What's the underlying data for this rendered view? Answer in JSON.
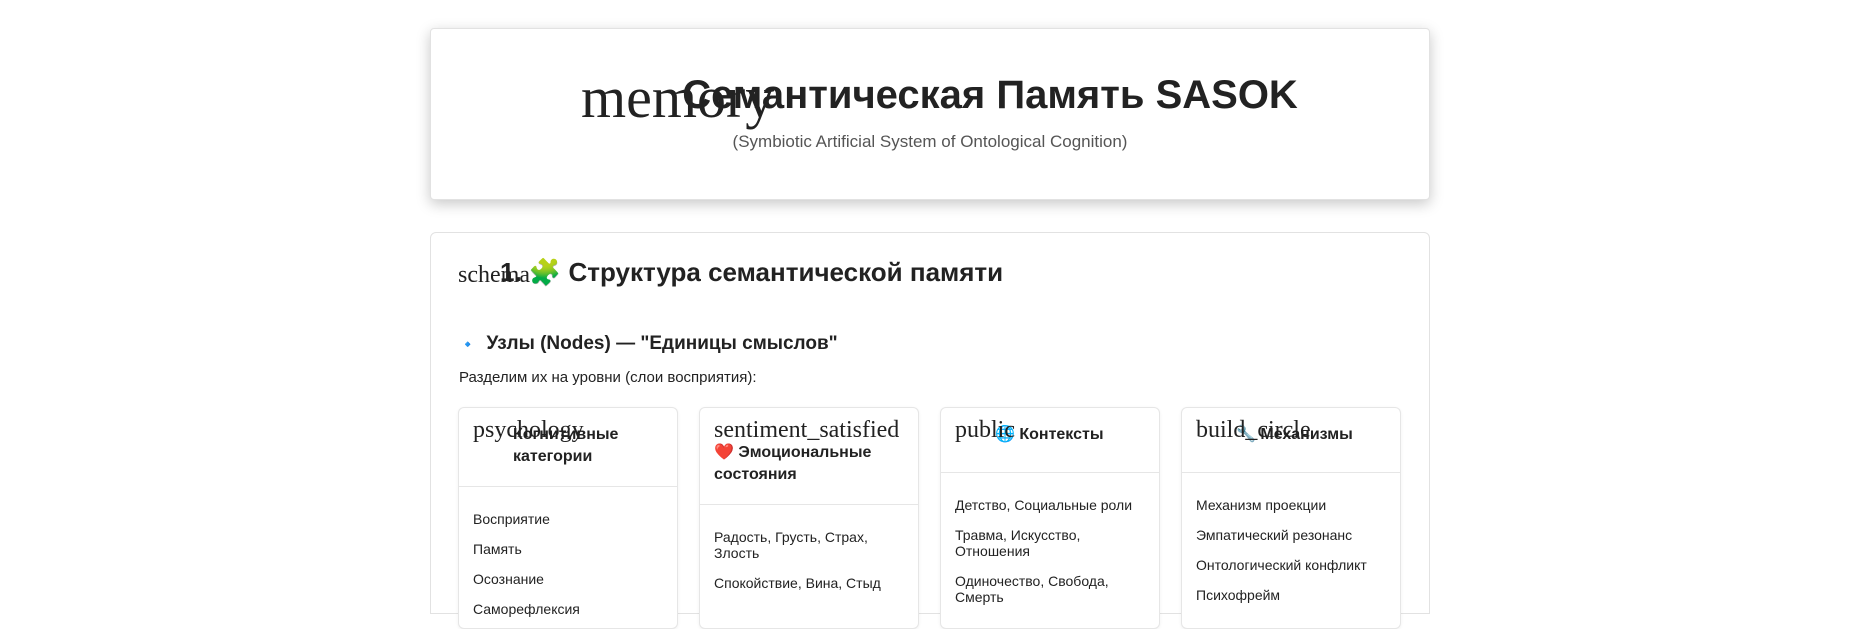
{
  "header": {
    "icon_ligature": "memory",
    "title": "Семантическая Память SASOK",
    "subtitle": "(Symbiotic Artificial System of Ontological Cognition)"
  },
  "section": {
    "icon_ligature": "schema",
    "title": "1. 🧩 Структура семантической памяти",
    "subsection_icon": "🔹",
    "subsection_title": "Узлы (Nodes) — \"Единицы смыслов\"",
    "intro": "Разделим их на уровни (слои восприятия):"
  },
  "nodes": [
    {
      "icon_ligature": "psychology",
      "title": "Когнитивные категории",
      "items": [
        "Восприятие",
        "Память",
        "Осознание",
        "Саморефлексия"
      ]
    },
    {
      "icon_ligature": "sentiment_satisfied",
      "title": "❤️ Эмоциональные состояния",
      "items": [
        "Радость, Грусть, Страх, Злость",
        "Спокойствие, Вина, Стыд"
      ]
    },
    {
      "icon_ligature": "public",
      "title": "🌐 Контексты",
      "items": [
        "Детство, Социальные роли",
        "Травма, Искусство, Отношения",
        "Одиночество, Свобода, Смерть"
      ]
    },
    {
      "icon_ligature": "build_circle",
      "title": "🔧 Механизмы",
      "items": [
        "Механизм проекции",
        "Эмпатический резонанс",
        "Онтологический конфликт",
        "Психофрейм"
      ]
    }
  ]
}
